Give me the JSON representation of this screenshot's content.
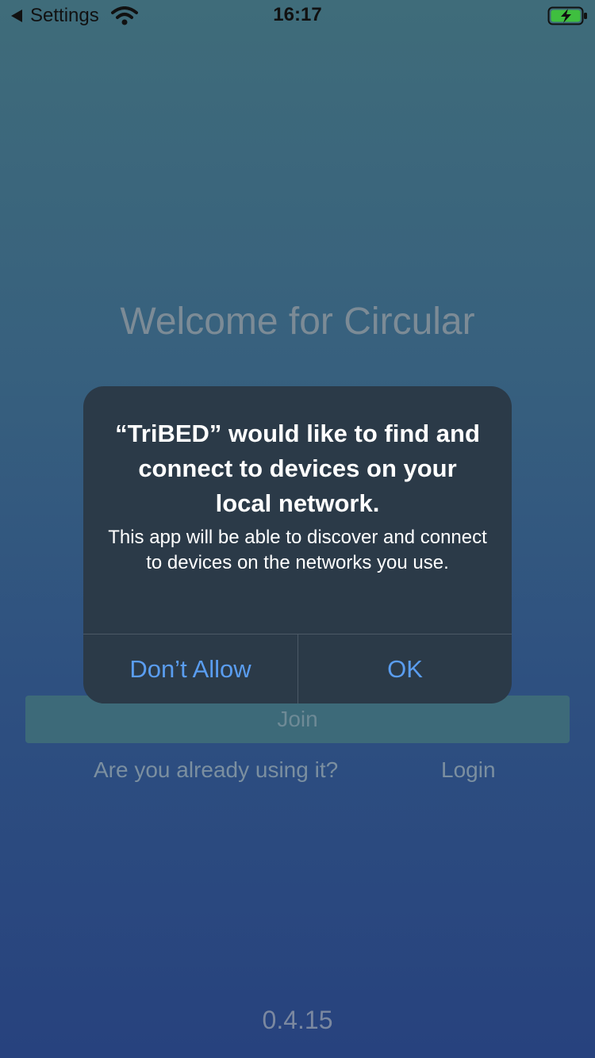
{
  "status_bar": {
    "back_label": "Settings",
    "time": "16:17",
    "icons": [
      "back-arrow-icon",
      "wifi-icon",
      "battery-charging-icon"
    ]
  },
  "main": {
    "title": "Welcome for Circular",
    "join_label": "Join",
    "already_using_text": "Are you already using it?",
    "login_label": "Login",
    "version": "0.4.15"
  },
  "alert": {
    "title": "“TriBED” would like to find and connect to devices on your local network.",
    "message": "This app will be able to discover and connect to devices on the networks you use.",
    "deny_label": "Don’t Allow",
    "ok_label": "OK"
  },
  "colors": {
    "background_top": "#3f6c7a",
    "background_bottom": "#27427e",
    "alert_background": "#2b3a48",
    "alert_button_text": "#5a9df0",
    "battery_fill": "#3fbf3f"
  }
}
